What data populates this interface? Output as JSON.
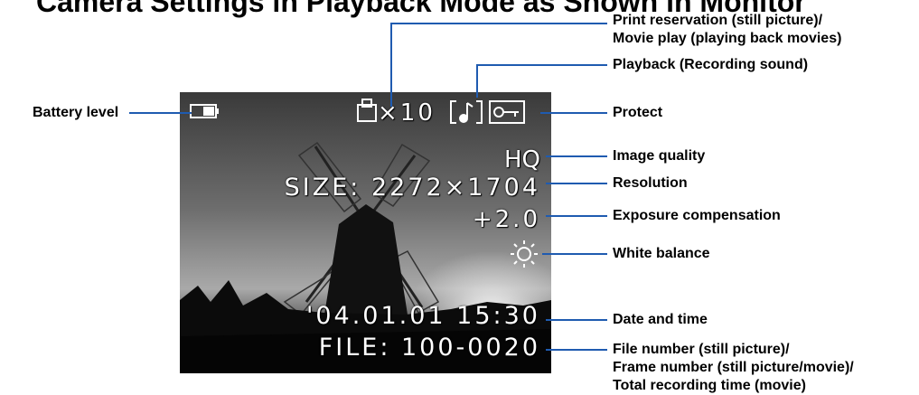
{
  "page": {
    "title": "Camera Settings in Playback Mode as Shown in Monitor",
    "colors": {
      "leader": "#1f5bb0",
      "text": "#000000",
      "osd_text": "#ffffff"
    }
  },
  "screen": {
    "print_count": "×10",
    "image_quality": "HQ",
    "resolution": "SIZE: 2272×1704",
    "exposure": "+2.0",
    "date_time": "'04.01.01  15:30",
    "file_number": "FILE: 100-0020",
    "icons": [
      "battery-icon",
      "print-reservation-icon",
      "sound-icon",
      "protect-icon",
      "white-balance-sun-icon"
    ]
  },
  "callouts": {
    "battery": "Battery level",
    "print_line1": "Print reservation (still picture)/",
    "print_line2": "Movie play (playing back movies)",
    "playback_sound": "Playback (Recording sound)",
    "protect": "Protect",
    "image_quality": "Image quality",
    "resolution": "Resolution",
    "exposure": "Exposure compensation",
    "white_balance": "White balance",
    "date_time": "Date and time",
    "file_line1": "File number (still picture)/",
    "file_line2": "Frame number (still picture/movie)/",
    "file_line3": "Total recording time (movie)"
  }
}
